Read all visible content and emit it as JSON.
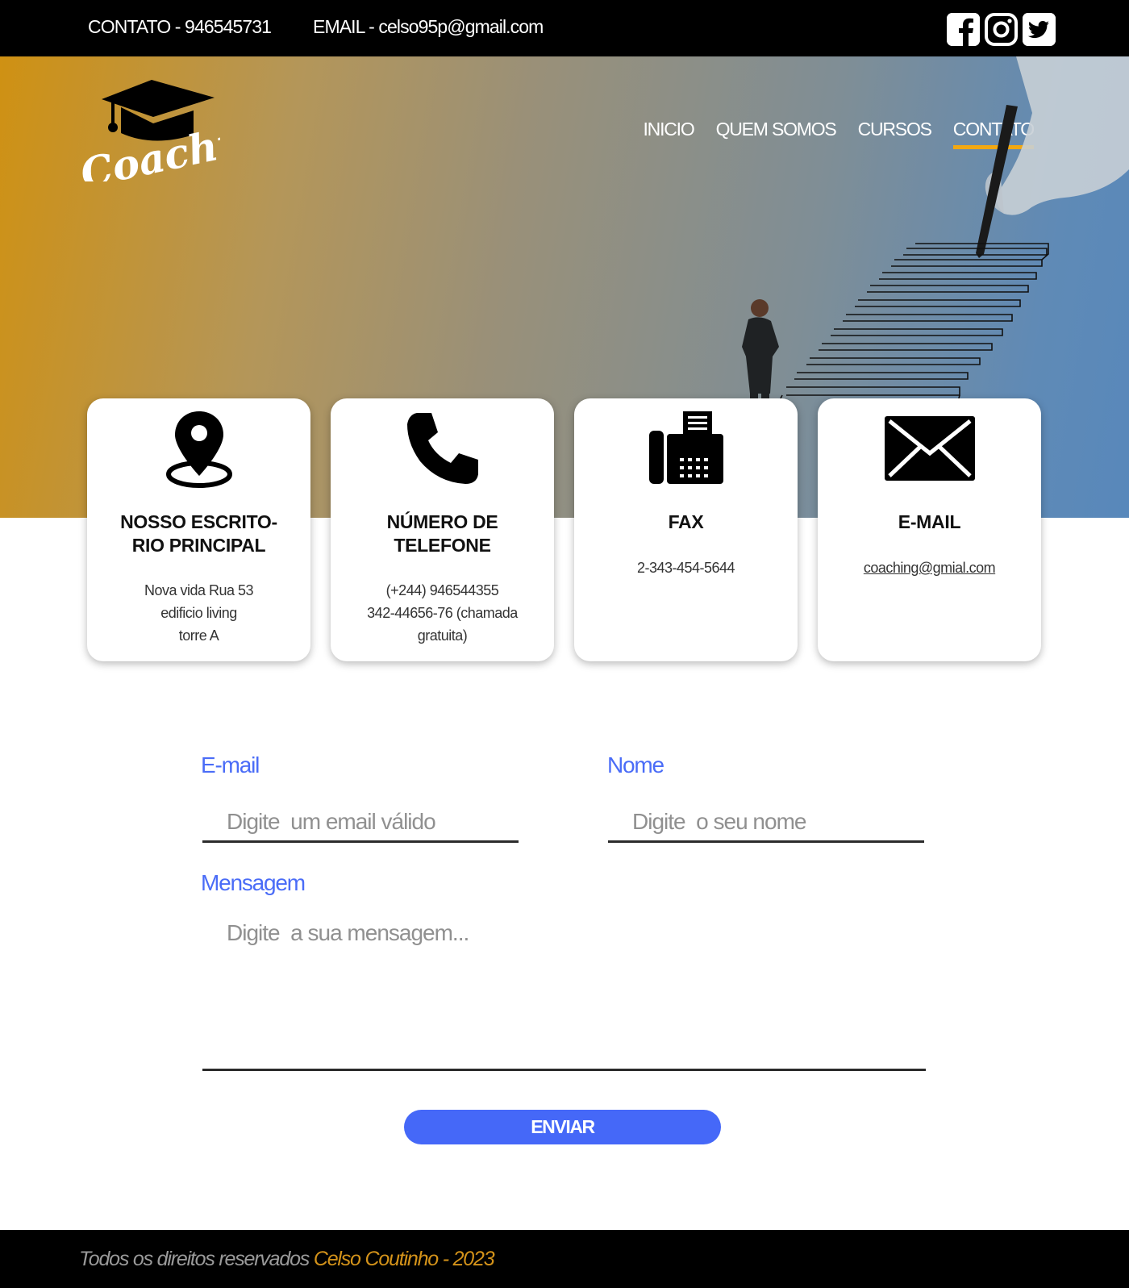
{
  "topbar": {
    "contact": "CONTATO - 946545731",
    "email": "EMAIL - celso95p@gmail.com",
    "social": [
      "facebook-icon",
      "instagram-icon",
      "twitter-icon"
    ]
  },
  "logo": {
    "text": "Coaching"
  },
  "nav": {
    "items": [
      {
        "label": "INICIO"
      },
      {
        "label": "QUEM SOMOS"
      },
      {
        "label": "CURSOS"
      },
      {
        "label": "CONTATO",
        "active": true
      }
    ]
  },
  "cards": [
    {
      "icon": "location-pin-icon",
      "title_line1": "NOSSO ESCRITO-",
      "title_line2": "RIO PRINCIPAL",
      "info": [
        "Nova vida Rua 53",
        "edificio living",
        "torre A"
      ]
    },
    {
      "icon": "phone-icon",
      "title_line1": "NÚMERO DE",
      "title_line2": "TELEFONE",
      "info": [
        "(+244) 946544355",
        "342-44656-76 (chamada",
        "gratuita)"
      ]
    },
    {
      "icon": "fax-icon",
      "title_line1": "FAX",
      "info": [
        "2-343-454-5644"
      ]
    },
    {
      "icon": "envelope-icon",
      "title_line1": "E-MAIL",
      "info": [
        "coaching@gmial.com"
      ]
    }
  ],
  "form": {
    "email_label": "E-mail",
    "email_placeholder": "Digite  um email válido",
    "name_label": "Nome",
    "name_placeholder": "Digite  o seu nome",
    "message_label": "Mensagem",
    "message_placeholder": "Digite  a sua mensagem...",
    "submit_label": "ENVIAR"
  },
  "footer": {
    "text": "Todos os direitos reservados ",
    "author": "Celso Coutinho - 2023"
  },
  "colors": {
    "accent_blue": "#4568f8",
    "accent_orange": "#f2a812",
    "footer_author": "#d4931a"
  }
}
